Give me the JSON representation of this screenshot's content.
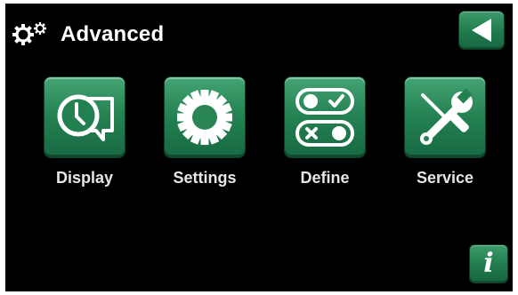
{
  "header": {
    "title": "Advanced",
    "title_icon": "gears-icon",
    "back_icon": "back-arrow-icon"
  },
  "menu": {
    "items": [
      {
        "label": "Display",
        "icon": "clock-display-icon"
      },
      {
        "label": "Settings",
        "icon": "gear-icon"
      },
      {
        "label": "Define",
        "icon": "toggle-switches-icon"
      },
      {
        "label": "Service",
        "icon": "tools-icon"
      }
    ]
  },
  "footer": {
    "info_label": "i",
    "info_icon": "info-icon"
  },
  "colors": {
    "background": "#000000",
    "button_green": "#238051",
    "text": "#ffffff"
  }
}
